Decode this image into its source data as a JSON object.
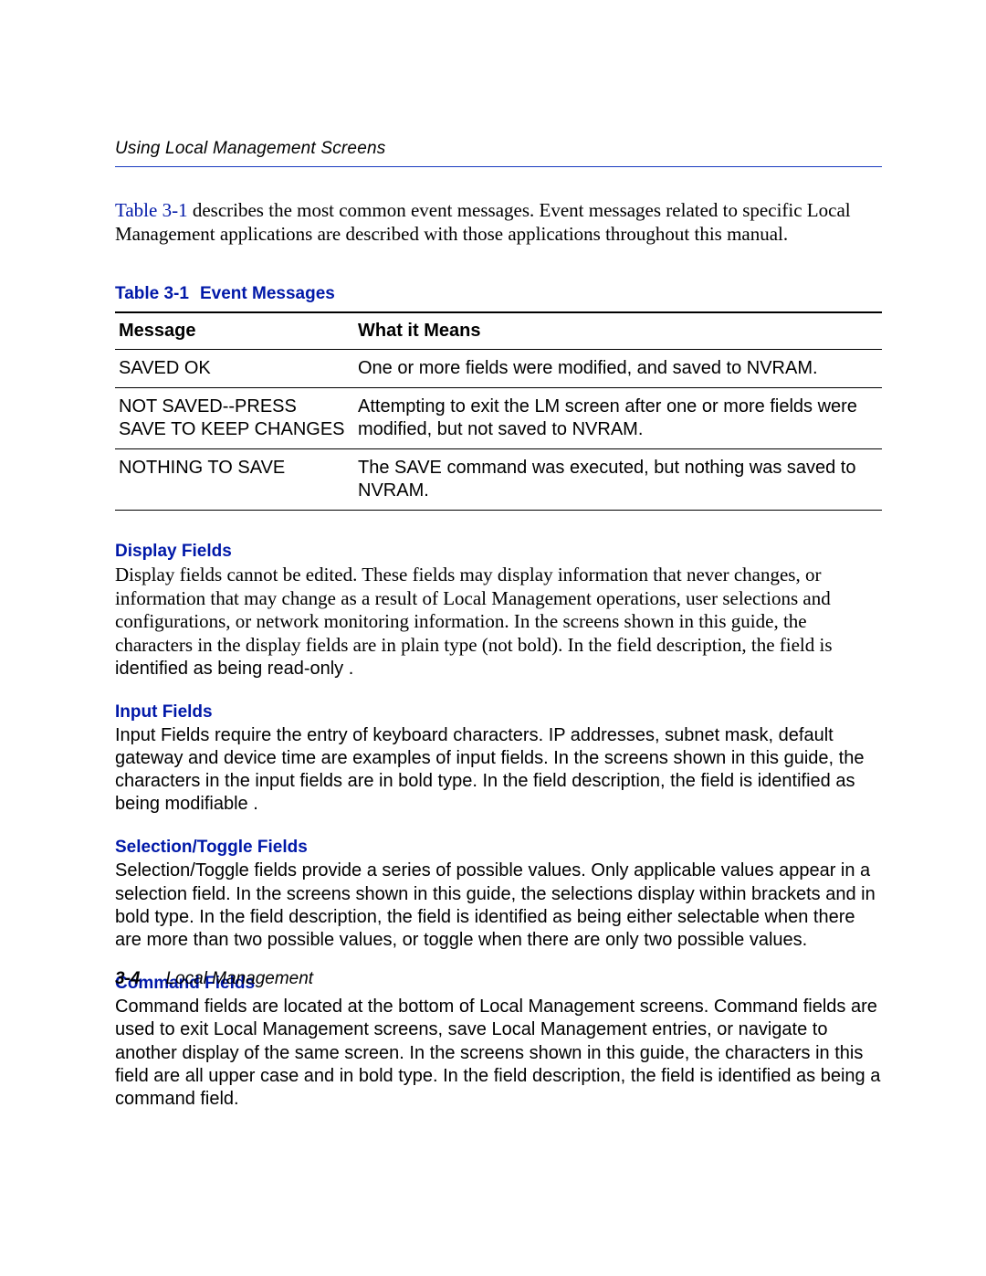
{
  "header": {
    "running_title": "Using Local Management Screens"
  },
  "intro": {
    "link_text": "Table 3-1",
    "rest": " describes the most common event messages. Event messages related to specific Local Management applications are described with those applications throughout this manual."
  },
  "table": {
    "caption_number": "Table 3-1",
    "caption_title": "Event Messages",
    "head_message": "Message",
    "head_meaning": "What it Means",
    "rows": [
      {
        "msg": "SAVED OK",
        "mean": "One or more fields were modified, and saved to NVRAM."
      },
      {
        "msg": "NOT SAVED--PRESS SAVE TO KEEP CHANGES",
        "mean": "Attempting to exit the LM screen after one or more fields were modified, but not saved to NVRAM."
      },
      {
        "msg": "NOTHING TO SAVE",
        "mean": "The SAVE command was executed, but nothing was saved to NVRAM."
      }
    ]
  },
  "sections": [
    {
      "title": "Display Fields",
      "body_serif": "Display fields cannot be edited. These fields may display information that never changes, or information that may change as a result of Local Management operations, user selections and configurations, or network monitoring information. In the screens shown in this guide, the characters in the display fields are in plain type (not bold). In the field description, the field is",
      "body_sans": "identified as being  read-only ."
    },
    {
      "title": "Input Fields",
      "body_sans": "Input Fields require the entry of keyboard characters. IP addresses, subnet  mask, default gateway and device time are examples of input fields. In the screens shown in this guide, the characters in the input fields are in bold type. In the field description, the field is identified as being  modifiable ."
    },
    {
      "title": "Selection/Toggle Fields",
      "body_sans": "Selection/Toggle fields provide a series of possible values. Only applicable values appear in a selection field. In the screens shown in this guide, the selections display within brackets and in bold type. In the field description, the field is identified as being either  selectable  when there are more than two possible values, or  toggle  when there are only two possible values."
    },
    {
      "title": "Command Fields",
      "body_sans": "Command fields are located at the bottom of Local Management screens. Command fields are used to exit Local Management screens, save Local Management entries, or navigate to another display of the same screen. In the screens shown in this guide, the characters in this field are all upper case and in bold type. In the field description, the field is identified as being a  command  field."
    }
  ],
  "footer": {
    "page": "3-4",
    "doc": "Local Management"
  }
}
